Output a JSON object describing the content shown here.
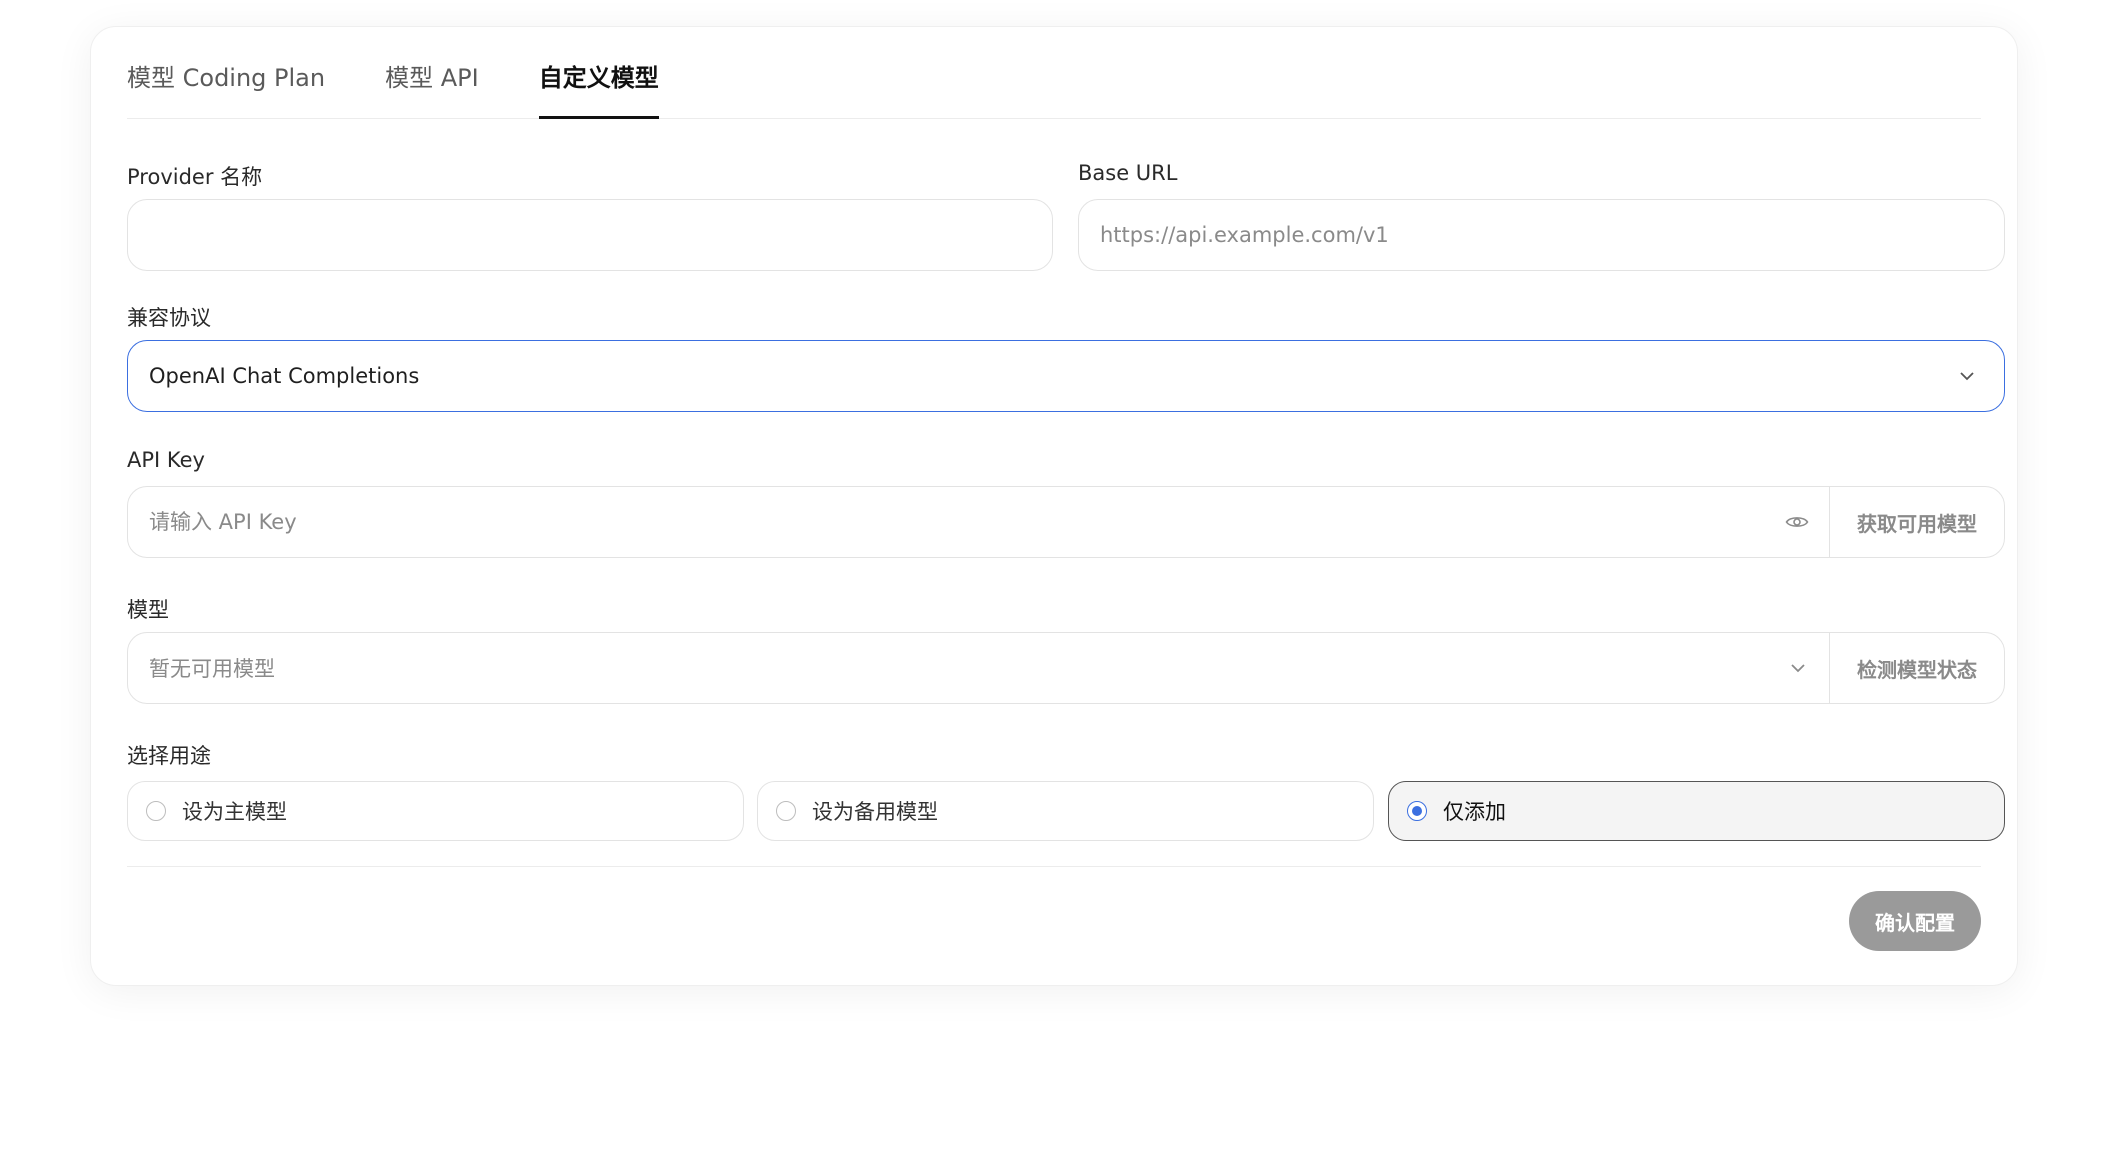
{
  "tabs": [
    {
      "label": "模型 Coding Plan"
    },
    {
      "label": "模型 API"
    },
    {
      "label": "自定义模型"
    }
  ],
  "provider": {
    "label": "Provider 名称",
    "value": ""
  },
  "base_url": {
    "label": "Base URL",
    "placeholder": "https://api.example.com/v1"
  },
  "protocol": {
    "label": "兼容协议",
    "value": "OpenAI Chat Completions"
  },
  "api_key": {
    "label": "API Key",
    "placeholder": "请输入 API Key",
    "fetch_button": "获取可用模型"
  },
  "model": {
    "label": "模型",
    "placeholder": "暂无可用模型",
    "check_button": "检测模型状态"
  },
  "purpose": {
    "label": "选择用途",
    "options": [
      {
        "label": "设为主模型"
      },
      {
        "label": "设为备用模型"
      },
      {
        "label": "仅添加"
      }
    ],
    "selected": "仅添加"
  },
  "confirm_button": "确认配置",
  "colors": {
    "accent": "#3b6fe0",
    "button_disabled": "#9a9a9a"
  }
}
